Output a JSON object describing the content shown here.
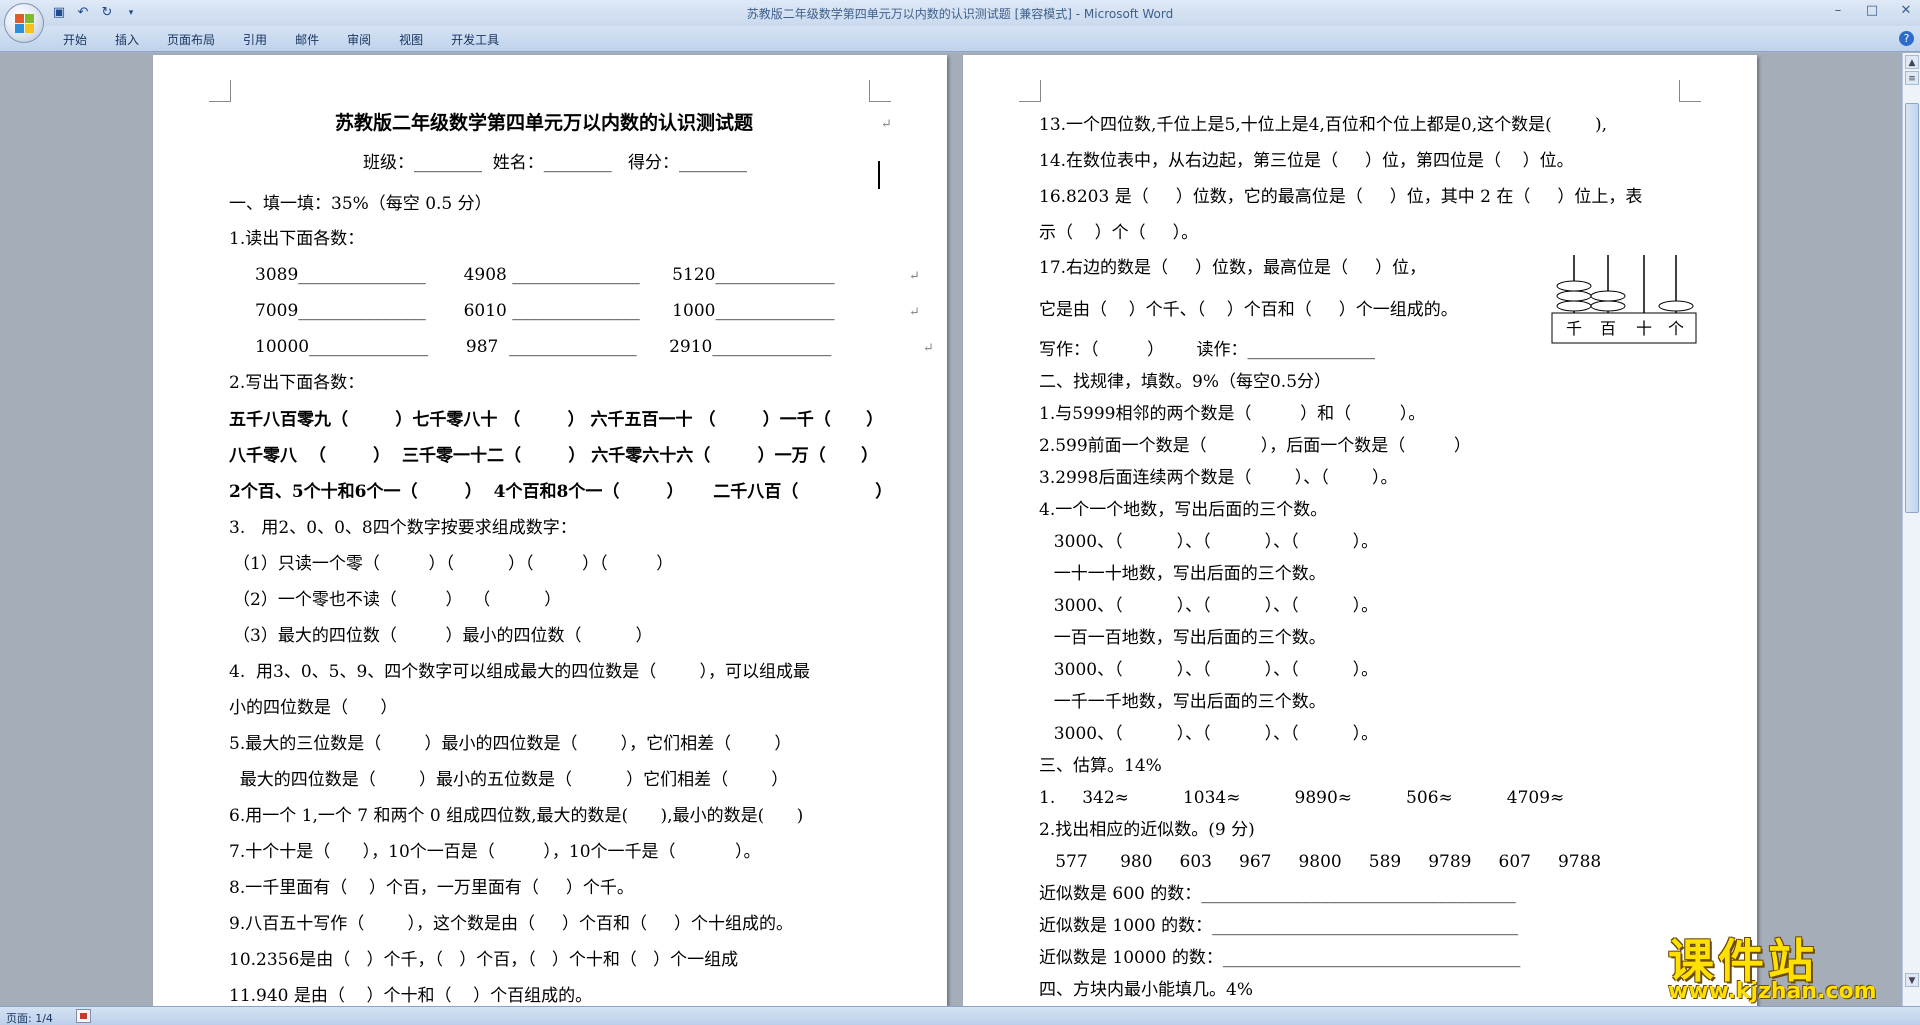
{
  "window": {
    "title": "苏教版二年级数学第四单元万以内数的认识测试题 [兼容模式] - Microsoft Word",
    "qat": [
      "save-icon",
      "undo-icon",
      "redo-icon",
      "customize-icon"
    ],
    "controls": [
      "minimize-icon",
      "maximize-icon",
      "close-icon"
    ]
  },
  "ribbon": {
    "tabs": [
      "开始",
      "插入",
      "页面布局",
      "引用",
      "邮件",
      "审阅",
      "视图",
      "开发工具"
    ],
    "help": "?"
  },
  "status": {
    "page": "页面: 1/4"
  },
  "page1": {
    "lines": [
      "苏教版二年级数学第四单元万以内数的认识测试题",
      "班级：________  姓名：________   得分：________",
      "一、填一填：35%（每空 0.5 分）",
      "1.读出下面各数：",
      "3089_______________       4908 _______________      5120______________",
      "7009_______________       6010 _______________      1000______________",
      "10000______________       987  _______________      2910______________",
      "2.写出下面各数：",
      "五千八百零九（        ）七千零八十 （        ） 六千五百一十 （        ）一千（      ）",
      "八千零八  （        ）  三千零一十二（        ） 六千零六十六（        ）一万（      ）",
      "2个百、5个十和6个一（        ）  4个百和8个一（        ）     二千八百（             ）",
      "3.   用2、0、0、8四个数字按要求组成数字：",
      "（1）只读一个零（         ）（          ）（         ）（         ）",
      "（2）一个零也不读（         ）  （          ）",
      "（3）最大的四位数（         ）最小的四位数（          ）",
      "4.  用3、0、5、9、四个数字可以组成最大的四位数是（        ），可以组成最",
      "小的四位数是（      ）",
      "5.最大的三位数是（        ）最小的四位数是（        ），它们相差（        ）",
      "  最大的四位数是（        ）最小的五位数是（          ）它们相差（        ）",
      "6.用一个 1,一个 7 和两个 0 组成四位数,最大的数是(      ),最小的数是(      )",
      "7.十个十是（      ），10个一百是（         ），10个一千是（           ）。",
      "8.一千里面有（    ）个百，一万里面有（     ）个千。",
      "9.八百五十写作（        ），这个数是由（     ）个百和（     ）个十组成的。",
      "10.2356是由（   ）个千，（   ）个百，（   ）个十和（   ）个一组成",
      "11.940 是由（    ）个十和（    ）个百组成的。"
    ]
  },
  "page2": {
    "lines": [
      "13.一个四位数,千位上是5,十位上是4,百位和个位上都是0,这个数是(        ),",
      "14.在数位表中，从右边起，第三位是（     ）位，第四位是（    ）位。",
      "16.8203 是（     ）位数，它的最高位是（     ）位，其中 2 在（     ）位上，表",
      "示（    ）个（     ）。",
      "17.右边的数是（     ）位数，最高位是（     ）位，",
      "它是由（    ）个千、（    ）个百和（     ）个一组成的。",
      "写作：（         ）      读作：_______________",
      "二、找规律，填数。9%（每空0.5分）",
      "1.与5999相邻的两个数是（         ）和（         ）。",
      "2.599前面一个数是（          ），后面一个数是（         ）",
      "3.2998后面连续两个数是（        ）、（        ）。",
      "4.一个一个地数，写出后面的三个数。",
      "  3000、（          ）、（          ）、（          ）。",
      "  一十一十地数，写出后面的三个数。",
      "  3000、（          ）、（          ）、（          ）。",
      "  一百一百地数，写出后面的三个数。",
      "  3000、（          ）、（          ）、（          ）。",
      "  一千一千地数，写出后面的三个数。",
      "  3000、（          ）、（          ）、（          ）。",
      "三、估算。14%",
      "1.     342≈          1034≈          9890≈          506≈          4709≈",
      "2.找出相应的近似数。(9 分)",
      "   577      980     603     967     9800     589     9789     607     9788",
      "近似数是 600 的数：_____________________________________",
      "近似数是 1000 的数：____________________________________",
      "近似数是 10000 的数：___________________________________",
      "四、方块内最小能填几。4%"
    ],
    "abacus_labels": [
      "千",
      "百",
      "十",
      "个"
    ]
  },
  "watermark": {
    "text": "课件站",
    "url": "www.kjzhan.com"
  }
}
